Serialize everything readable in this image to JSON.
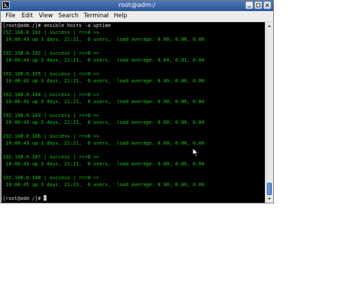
{
  "window": {
    "title": "root@adm:/"
  },
  "menu": [
    "File",
    "Edit",
    "View",
    "Search",
    "Terminal",
    "Help"
  ],
  "terminal": {
    "lines": [
      {
        "text": "[root@adm /]# ansible hosts -a uptime",
        "kind": "prompt"
      },
      {
        "text": "192.168.0.101 | success | rc=0 >>",
        "kind": "ok"
      },
      {
        "text": " 10:06:43 up 3 days, 21:21,  0 users,  load average: 0.00, 0.00, 0.00",
        "kind": "ok"
      },
      {
        "text": "",
        "kind": "ok"
      },
      {
        "text": "192.168.0.102 | success | rc=0 >>",
        "kind": "ok"
      },
      {
        "text": " 10:06:43 up 3 days, 21:21,  0 users,  load average: 0.04, 0.01, 0.00",
        "kind": "ok"
      },
      {
        "text": "",
        "kind": "ok"
      },
      {
        "text": "192.168.0.105 | success | rc=0 >>",
        "kind": "ok"
      },
      {
        "text": " 10:06:43 up 3 days, 21:21,  0 users,  load average: 0.00, 0.00, 0.00",
        "kind": "ok"
      },
      {
        "text": "",
        "kind": "ok"
      },
      {
        "text": "192.168.0.104 | success | rc=0 >>",
        "kind": "ok"
      },
      {
        "text": " 10:06:43 up 3 days, 21:21,  0 users,  load average: 0.00, 0.00, 0.00",
        "kind": "ok"
      },
      {
        "text": "",
        "kind": "ok"
      },
      {
        "text": "192.168.0.103 | success | rc=0 >>",
        "kind": "ok"
      },
      {
        "text": " 10:06:43 up 3 days, 21:21,  0 users,  load average: 0.00, 0.00, 0.00",
        "kind": "ok"
      },
      {
        "text": "",
        "kind": "ok"
      },
      {
        "text": "192.168.0.106 | success | rc=0 >>",
        "kind": "ok"
      },
      {
        "text": " 10:06:43 up 3 days, 21:21,  0 users,  load average: 0.00, 0.00, 0.00",
        "kind": "ok"
      },
      {
        "text": "",
        "kind": "ok"
      },
      {
        "text": "192.168.0.107 | success | rc=0 >>",
        "kind": "ok"
      },
      {
        "text": " 10:06:43 up 3 days, 21:21,  0 users,  load average: 0.00, 0.00, 0.00",
        "kind": "ok"
      },
      {
        "text": "",
        "kind": "ok"
      },
      {
        "text": "192.168.0.108 | success | rc=0 >>",
        "kind": "ok"
      },
      {
        "text": " 10:06:45 up 3 days, 21:23,  0 users,  load average: 0.00, 0.00, 0.00",
        "kind": "ok"
      },
      {
        "text": "",
        "kind": "ok"
      },
      {
        "text": "[root@adm /]# ",
        "kind": "prompt-cursor"
      }
    ]
  },
  "colors": {
    "titlebar": "#2a5596",
    "output": "#19c519",
    "prompt": "#d8d8d8",
    "background": "#000000"
  },
  "icons": {
    "app": "terminal-icon",
    "minimize": "minimize-icon",
    "maximize": "maximize-icon",
    "close": "close-icon",
    "pointer": "mouse-pointer-icon"
  }
}
